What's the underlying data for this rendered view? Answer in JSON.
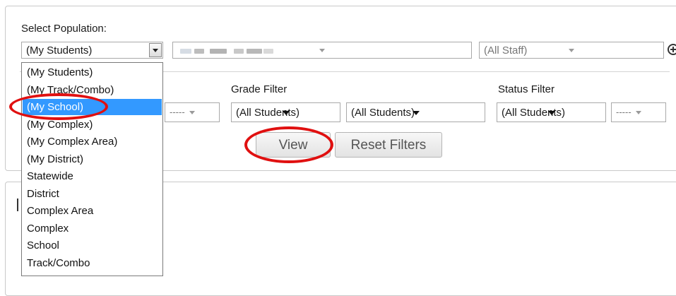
{
  "population": {
    "label": "Select Population:",
    "selected": "(My Students)",
    "staff_selected": "(All Staff)",
    "options": [
      "(My Students)",
      "(My Track/Combo)",
      "(My School)",
      "(My Complex)",
      "(My Complex Area)",
      "(My District)",
      "Statewide",
      "District",
      "Complex Area",
      "Complex",
      "School",
      "Track/Combo"
    ],
    "highlighted_option": "(My School)"
  },
  "filters": {
    "grade_label": "Grade Filter",
    "status_label": "Status Filter",
    "left_dash": "-----",
    "grade_select_1": "(All Students)",
    "grade_select_2": "(All Students)",
    "status_select": "(All Students)",
    "status_dash": "-----"
  },
  "buttons": {
    "view": "View",
    "reset": "Reset Filters"
  },
  "colors": {
    "selection": "#3399ff",
    "annotation": "#e01010"
  }
}
